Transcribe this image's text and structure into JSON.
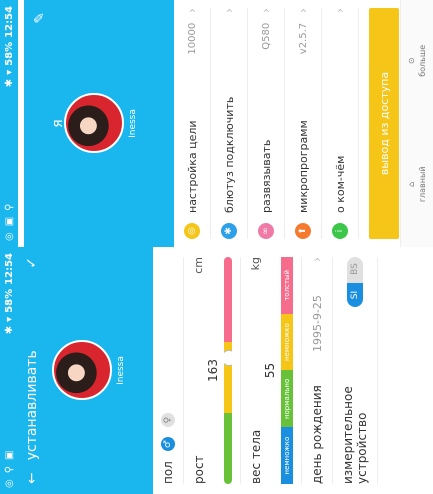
{
  "colors": {
    "accent": "#1ab6ee",
    "blue": "#1a8fe0",
    "yellow": "#f5c518"
  },
  "status": {
    "time": "12:54",
    "battery": "58%"
  },
  "profile": {
    "title": "устанавливать",
    "username": "Inessa",
    "gender_label": "пол",
    "height_label": "рост",
    "height_value": "163",
    "height_unit": "cm",
    "weight_label": "вес тела",
    "weight_value": "55",
    "weight_unit": "kg",
    "weight_segments": [
      "немножко",
      "нормально",
      "немножко",
      "толстый"
    ],
    "birthday_label": "день рождения",
    "birthday_value": "1995-9-25",
    "measure_label": "измерительное устройство",
    "toggle_on": "SI",
    "toggle_off": "BS"
  },
  "settings": {
    "title": "я",
    "username": "Inessa",
    "items": [
      {
        "label": "настройка цели",
        "value": "10000",
        "icon": "target-icon",
        "color": "#f5c518"
      },
      {
        "label": "блютуз подключить",
        "value": "",
        "icon": "bluetooth-icon",
        "color": "#2ca0e8"
      },
      {
        "label": "развязывать",
        "value": "Q580",
        "icon": "link-icon",
        "color": "#f07aa6"
      },
      {
        "label": "микропрограмм",
        "value": "v2.5.7",
        "icon": "upgrade-icon",
        "color": "#f57a2e"
      },
      {
        "label": "о ком-чём",
        "value": "",
        "icon": "info-icon",
        "color": "#3cc64a"
      }
    ],
    "logout": "вывод из доступа",
    "tabs": [
      "главный",
      "больше"
    ]
  }
}
